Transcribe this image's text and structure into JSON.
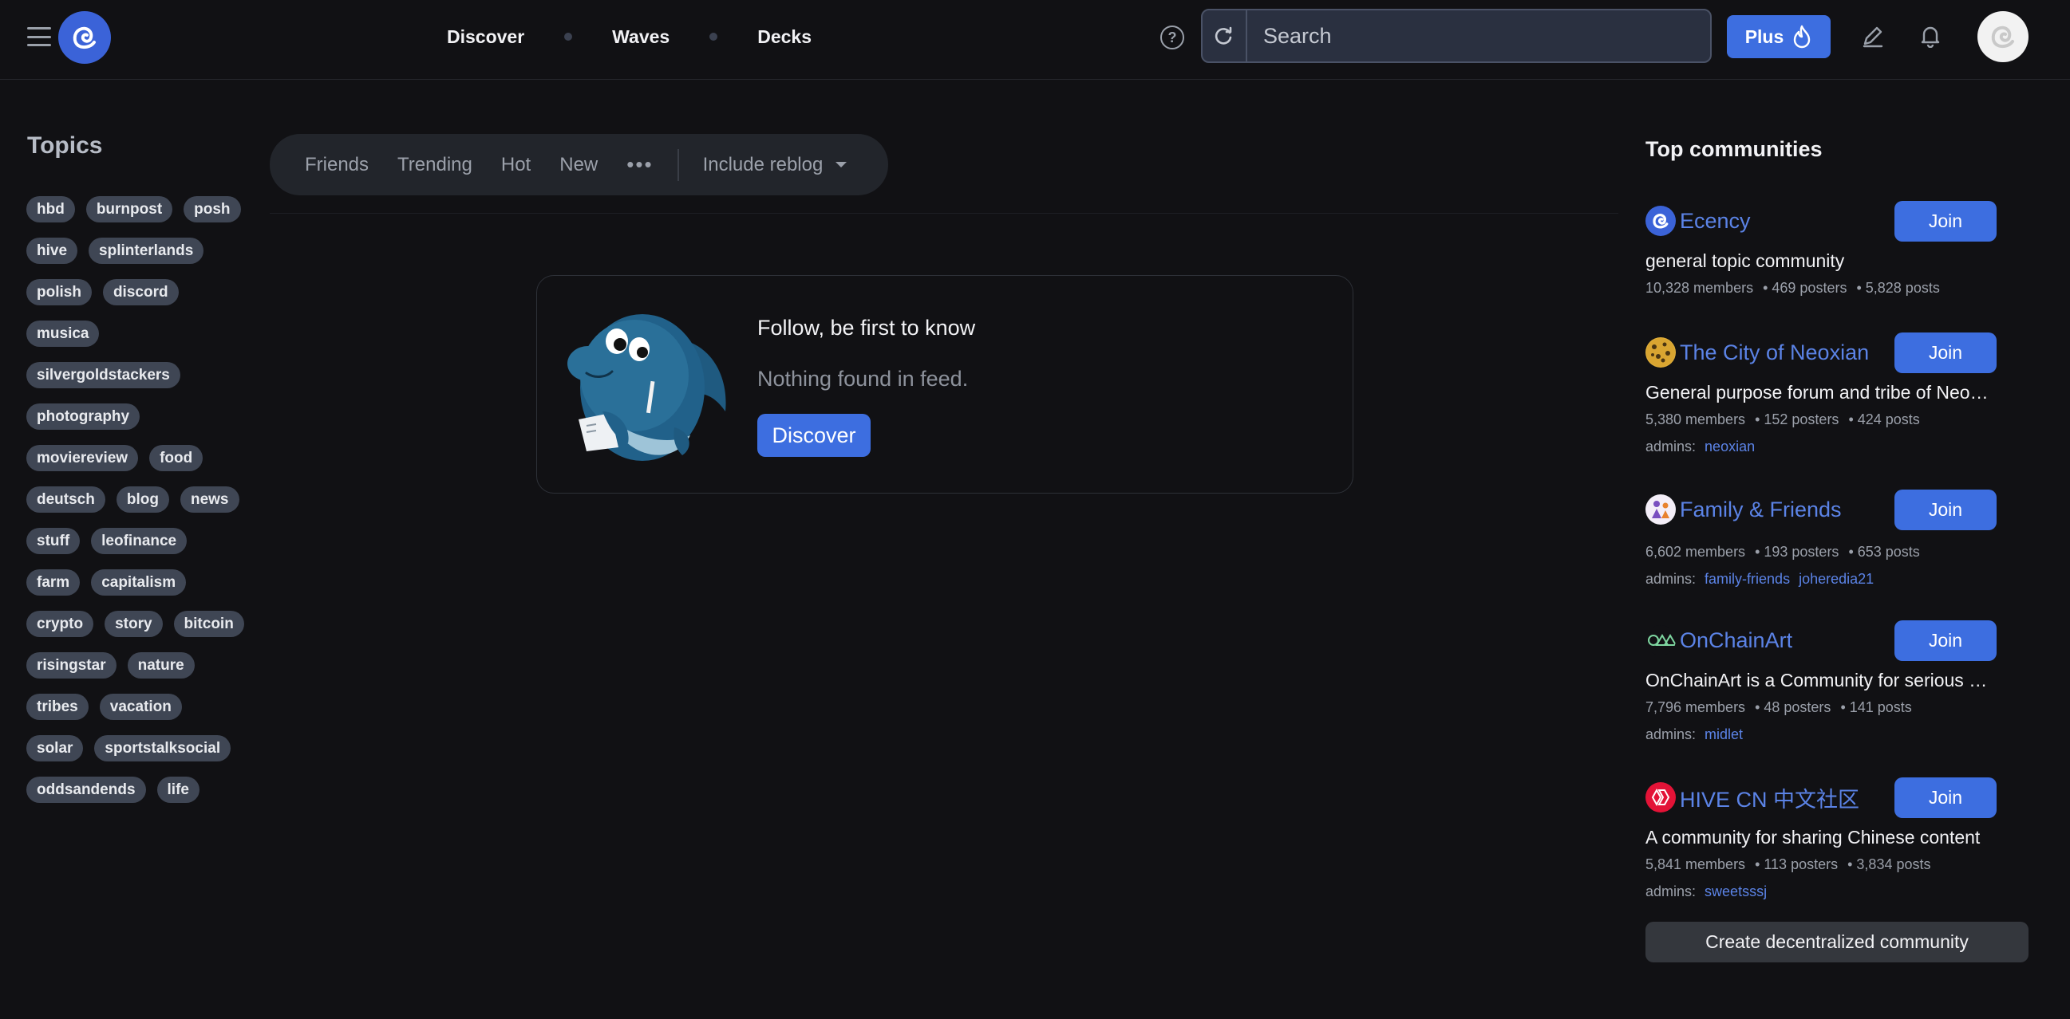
{
  "header": {
    "nav": [
      "Discover",
      "Waves",
      "Decks"
    ],
    "search_placeholder": "Search",
    "plus_label": "Plus"
  },
  "sidebar": {
    "title": "Topics",
    "tags": [
      "hbd",
      "burnpost",
      "posh",
      "hive",
      "splinterlands",
      "polish",
      "discord",
      "musica",
      "silvergoldstackers",
      "photography",
      "moviereview",
      "food",
      "deutsch",
      "blog",
      "news",
      "stuff",
      "leofinance",
      "farm",
      "capitalism",
      "crypto",
      "story",
      "bitcoin",
      "risingstar",
      "nature",
      "tribes",
      "vacation",
      "solar",
      "sportstalksocial",
      "oddsandends",
      "life"
    ]
  },
  "filters": {
    "items": [
      "Friends",
      "Trending",
      "Hot",
      "New"
    ],
    "more": "•••",
    "reblog_label": "Include reblog"
  },
  "feed": {
    "empty_title": "Follow, be first to know",
    "empty_subtitle": "Nothing found in feed.",
    "discover_label": "Discover"
  },
  "communities": {
    "title": "Top communities",
    "join_label": "Join",
    "admins_label": "admins:",
    "items": [
      {
        "name": "Ecency",
        "desc": "general topic community",
        "members": "10,328 members",
        "posters": "469 posters",
        "posts": "5,828 posts",
        "admins": []
      },
      {
        "name": "The City of Neoxian",
        "desc": "General purpose forum and tribe of Neoxian city",
        "members": "5,380 members",
        "posters": "152 posters",
        "posts": "424 posts",
        "admins": [
          "neoxian"
        ]
      },
      {
        "name": "Family & Friends",
        "desc": "",
        "members": "6,602 members",
        "posters": "193 posters",
        "posts": "653 posts",
        "admins": [
          "family-friends",
          "joheredia21"
        ]
      },
      {
        "name": "OnChainArt",
        "desc": "OnChainArt is a Community for serious artists",
        "members": "7,796 members",
        "posters": "48 posters",
        "posts": "141 posts",
        "admins": [
          "midlet"
        ]
      },
      {
        "name": "HIVE CN 中文社区",
        "desc": "A community for sharing Chinese content",
        "members": "5,841 members",
        "posters": "113 posters",
        "posts": "3,834 posts",
        "admins": [
          "sweetsssj"
        ]
      }
    ],
    "create_label": "Create decentralized community"
  }
}
